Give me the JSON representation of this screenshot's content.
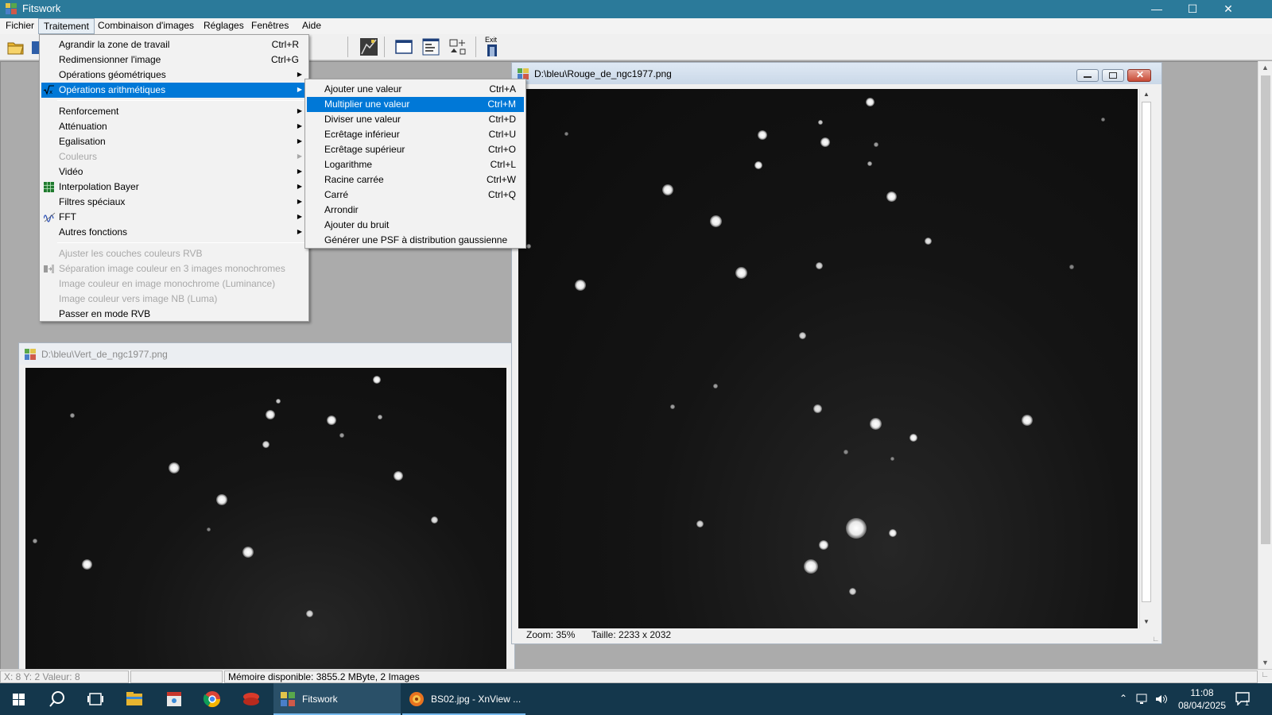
{
  "window": {
    "title": "Fitswork"
  },
  "menubar": [
    {
      "label": "Fichier"
    },
    {
      "label": "Traitement",
      "active": true
    },
    {
      "label": "Combinaison d'images"
    },
    {
      "label": "Réglages"
    },
    {
      "label": "Fenêtres"
    },
    {
      "label": "Aide"
    }
  ],
  "toolbar": {
    "exit_label": "Exit"
  },
  "traitement_menu": [
    {
      "label": "Agrandir la zone de travail",
      "shortcut": "Ctrl+R"
    },
    {
      "label": "Redimensionner l'image",
      "shortcut": "Ctrl+G"
    },
    {
      "label": "Opérations géométriques",
      "submenu": true
    },
    {
      "label": "Opérations arithmétiques",
      "submenu": true,
      "highlighted": true,
      "icon": "sqrt-icon"
    },
    {
      "separator": true
    },
    {
      "label": "Renforcement",
      "submenu": true
    },
    {
      "label": "Atténuation",
      "submenu": true
    },
    {
      "label": "Egalisation",
      "submenu": true
    },
    {
      "label": "Couleurs",
      "submenu": true,
      "disabled": true
    },
    {
      "label": "Vidéo",
      "submenu": true
    },
    {
      "label": "Interpolation Bayer",
      "submenu": true,
      "icon": "bayer-grid-icon"
    },
    {
      "label": "Filtres spéciaux",
      "submenu": true
    },
    {
      "label": "FFT",
      "submenu": true,
      "icon": "fft-wave-icon"
    },
    {
      "label": "Autres fonctions",
      "submenu": true
    },
    {
      "separator": true
    },
    {
      "label": "Ajuster les couches couleurs RVB",
      "disabled": true
    },
    {
      "label": "Séparation image couleur en 3 images monochromes",
      "disabled": true,
      "icon": "split-channels-icon"
    },
    {
      "label": "Image couleur en image monochrome (Luminance)",
      "disabled": true
    },
    {
      "label": "Image couleur vers image NB (Luma)",
      "disabled": true
    },
    {
      "label": "Passer en mode RVB"
    }
  ],
  "arith_submenu": [
    {
      "label": "Ajouter une valeur",
      "shortcut": "Ctrl+A"
    },
    {
      "label": "Multiplier une valeur",
      "shortcut": "Ctrl+M",
      "highlighted": true
    },
    {
      "label": "Diviser une valeur",
      "shortcut": "Ctrl+D"
    },
    {
      "label": "Ecrêtage inférieur",
      "shortcut": "Ctrl+U"
    },
    {
      "label": "Ecrêtage supérieur",
      "shortcut": "Ctrl+O"
    },
    {
      "label": "Logarithme",
      "shortcut": "Ctrl+L"
    },
    {
      "label": "Racine carrée",
      "shortcut": "Ctrl+W"
    },
    {
      "label": "Carré",
      "shortcut": "Ctrl+Q"
    },
    {
      "label": "Arrondir"
    },
    {
      "label": "Ajouter du bruit"
    },
    {
      "label": "Générer une PSF à distribution gaussienne"
    }
  ],
  "image_windows": {
    "rouge": {
      "title": "D:\\bleu\\Rouge_de_ngc1977.png",
      "zoom": "Zoom: 35%",
      "size": "Taille: 2233 x 2032"
    },
    "vert": {
      "title": "D:\\bleu\\Vert_de_ngc1977.png"
    }
  },
  "statusbar": {
    "coords": "X: 8  Y: 2  Valeur: 8",
    "blank": "",
    "memory": "Mémoire disponible: 3855.2 MByte, 2 Images"
  },
  "taskbar": {
    "tasks": [
      {
        "label": "Fitswork",
        "active": true
      },
      {
        "label": "BS02.jpg - XnView ..."
      }
    ],
    "time": "11:08",
    "date": "08/04/2025",
    "notification_count": "1"
  },
  "colors": {
    "titlebar": "#2b7a9a",
    "menu_highlight": "#0078d7",
    "taskbar": "#14374c"
  }
}
